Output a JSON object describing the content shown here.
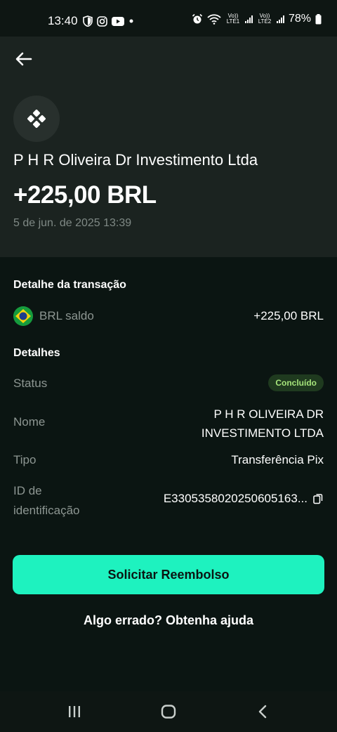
{
  "status_bar": {
    "time": "13:40",
    "lte1": "Vo)) LTE1",
    "lte2": "Vo)) LTE2",
    "battery": "78%"
  },
  "transaction": {
    "merchant": "P H R Oliveira Dr Investimento Ltda",
    "amount": "+225,00 BRL",
    "date": "5 de jun. de 2025 13:39"
  },
  "detail_section": {
    "title": "Detalhe da transação",
    "account_label": "BRL saldo",
    "account_amount": "+225,00 BRL"
  },
  "details": {
    "title": "Detalhes",
    "status_label": "Status",
    "status_value": "Concluído",
    "name_label": "Nome",
    "name_value_line1": "P H R OLIVEIRA DR",
    "name_value_line2": "INVESTIMENTO LTDA",
    "type_label": "Tipo",
    "type_value": "Transferência Pix",
    "id_label_line1": "ID de",
    "id_label_line2": "identificação",
    "id_value": "E3305358020250605163..."
  },
  "actions": {
    "refund_button": "Solicitar Reembolso",
    "help_link": "Algo errado? Obtenha ajuda"
  },
  "colors": {
    "accent": "#1ef2bf",
    "status_badge_bg": "#1f3a1f",
    "status_badge_text": "#a6e57b",
    "background": "#0b1512",
    "header_bg": "#1b2320"
  }
}
